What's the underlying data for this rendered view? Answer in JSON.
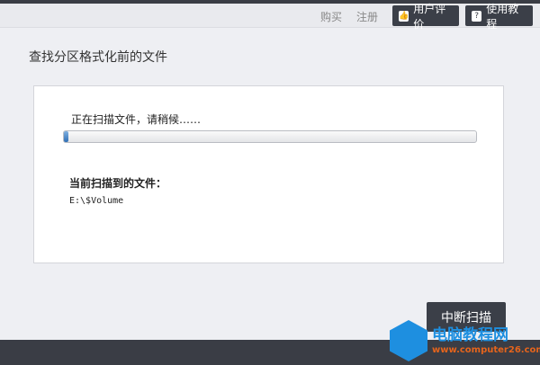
{
  "header": {
    "buy": "购买",
    "register": "注册",
    "review_btn": "用户评价",
    "tutorial_btn": "使用教程",
    "review_icon": "thumbs-up-icon",
    "tutorial_icon": "help-book-icon"
  },
  "page_title": "查找分区格式化前的文件",
  "scan": {
    "status": "正在扫描文件，请稍候……",
    "progress_percent": 1,
    "current_label": "当前扫描到的文件：",
    "current_file": "E:\\$Volume"
  },
  "stop_button": "中断扫描",
  "watermark": {
    "name": "电脑教程网",
    "url": "www.computer26.com"
  },
  "colors": {
    "accent": "#3b3f48",
    "progress": "#2f6fb5"
  }
}
